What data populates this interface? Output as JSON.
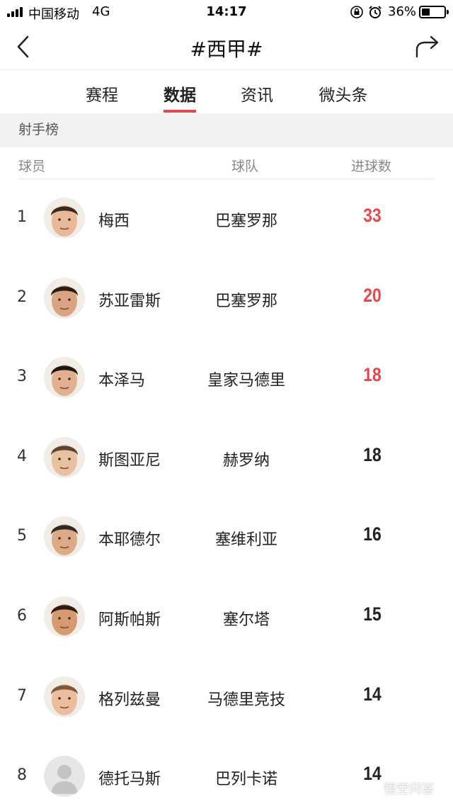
{
  "status_bar": {
    "carrier": "中国移动",
    "network": "4G",
    "time": "14:17",
    "battery_pct": "36%",
    "battery_level": 0.36
  },
  "nav": {
    "title": "#西甲#",
    "back_icon": "chevron-left-icon",
    "share_icon": "share-arrow-icon"
  },
  "tabs": [
    {
      "label": "赛程",
      "active": false
    },
    {
      "label": "数据",
      "active": true
    },
    {
      "label": "资讯",
      "active": false
    },
    {
      "label": "微头条",
      "active": false
    }
  ],
  "section": {
    "label": "射手榜"
  },
  "columns": {
    "player": "球员",
    "team": "球队",
    "goals": "进球数"
  },
  "rows": [
    {
      "rank": "1",
      "player": "梅西",
      "team": "巴塞罗那",
      "goals": "33",
      "highlight": true
    },
    {
      "rank": "2",
      "player": "苏亚雷斯",
      "team": "巴塞罗那",
      "goals": "20",
      "highlight": true
    },
    {
      "rank": "3",
      "player": "本泽马",
      "team": "皇家马德里",
      "goals": "18",
      "highlight": true
    },
    {
      "rank": "4",
      "player": "斯图亚尼",
      "team": "赫罗纳",
      "goals": "18",
      "highlight": false
    },
    {
      "rank": "5",
      "player": "本耶德尔",
      "team": "塞维利亚",
      "goals": "16",
      "highlight": false
    },
    {
      "rank": "6",
      "player": "阿斯帕斯",
      "team": "塞尔塔",
      "goals": "15",
      "highlight": false
    },
    {
      "rank": "7",
      "player": "格列兹曼",
      "team": "马德里竞技",
      "goals": "14",
      "highlight": false
    },
    {
      "rank": "8",
      "player": "德托马斯",
      "team": "巴列卡诺",
      "goals": "14",
      "highlight": false
    }
  ],
  "watermark": {
    "text": "悟空问答"
  },
  "colors": {
    "accent": "#e8474a",
    "section_bg": "#f2f2f2",
    "muted_text": "#888888"
  }
}
